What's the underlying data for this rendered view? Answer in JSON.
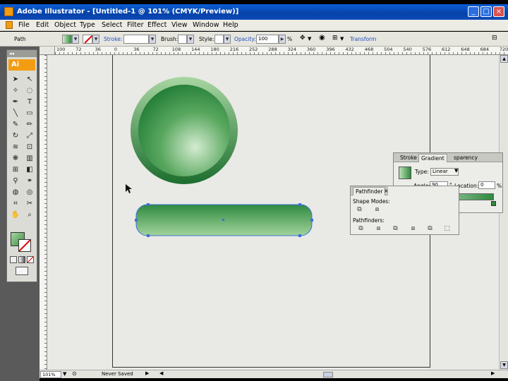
{
  "window": {
    "title": "Adobe Illustrator - [Untitled-1 @ 101% (CMYK/Preview)]",
    "min": "_",
    "max": "□",
    "close": "×"
  },
  "menu": [
    "File",
    "Edit",
    "Object",
    "Type",
    "Select",
    "Filter",
    "Effect",
    "View",
    "Window",
    "Help"
  ],
  "control": {
    "object_type": "Path",
    "stroke_label": "Stroke:",
    "brush_label": "Brush:",
    "style_label": "Style:",
    "opacity_label": "Opacity:",
    "opacity_value": "100",
    "percent": "%",
    "transform_label": "Transform"
  },
  "ruler_ticks": [
    "100",
    "72",
    "36",
    "0",
    "36",
    "72",
    "108",
    "144",
    "180",
    "216",
    "252",
    "288",
    "324",
    "360",
    "396",
    "432",
    "468",
    "504",
    "540",
    "576",
    "612",
    "648",
    "684",
    "720"
  ],
  "toolbox": {
    "badge": "Ai",
    "collapse": "◂◂"
  },
  "gradient_panel": {
    "tabs": [
      "Stroke",
      "Gradient",
      "sparency"
    ],
    "type_label": "Type:",
    "type_value": "Linear",
    "angle_label": "Angle:",
    "angle_value": "90",
    "degree": "°",
    "location_label": "Location:",
    "location_value": "0",
    "percent": "%"
  },
  "pathfinder_panel": {
    "tab": "Pathfinder",
    "shape_modes_label": "Shape Modes:",
    "pathfinders_label": "Pathfinders:"
  },
  "status": {
    "zoom": "101%",
    "state": "Never Saved"
  },
  "colors": {
    "circle_light": "#b9e0b2",
    "circle_dark": "#1e7a33",
    "bar_light": "#8cc48c",
    "bar_dark": "#2e8a42",
    "accent": "#0a5fd6",
    "selection": "#3d6fd6"
  }
}
